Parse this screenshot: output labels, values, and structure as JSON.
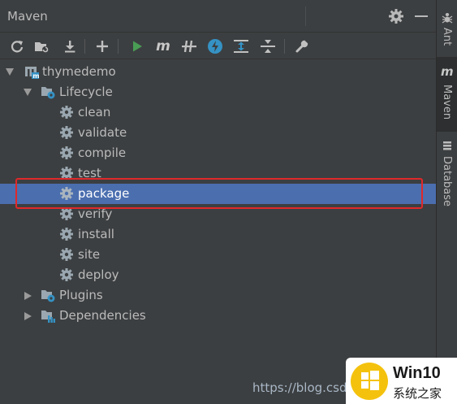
{
  "window": {
    "title": "Maven"
  },
  "toolbar": {
    "buttons": [
      {
        "name": "reload-all-icon"
      },
      {
        "name": "generate-sources-icon"
      },
      {
        "name": "download-icon"
      },
      {
        "name": "add-icon"
      },
      {
        "name": "run-icon"
      },
      {
        "name": "execute-goal-icon",
        "text": "m"
      },
      {
        "name": "skip-tests-icon"
      },
      {
        "name": "offline-mode-icon"
      },
      {
        "name": "show-dependencies-icon"
      },
      {
        "name": "collapse-all-icon"
      },
      {
        "name": "settings-wrench-icon"
      }
    ]
  },
  "tree": {
    "project": "thymedemo",
    "lifecycle": {
      "label": "Lifecycle",
      "goals": [
        "clean",
        "validate",
        "compile",
        "test",
        "package",
        "verify",
        "install",
        "site",
        "deploy"
      ],
      "selected": "package"
    },
    "plugins": "Plugins",
    "dependencies": "Dependencies"
  },
  "sidebar": {
    "tabs": [
      {
        "label": "Ant",
        "icon": "ant-icon"
      },
      {
        "label": "Maven",
        "icon": "maven-icon",
        "active": true
      },
      {
        "label": "Database",
        "icon": "database-icon"
      }
    ]
  },
  "overlay": {
    "watermark": "https://blog.csdn",
    "logo_title": "Win10",
    "logo_subtitle": "系统之家"
  },
  "colors": {
    "background": "#3c3f41",
    "selection": "#4b6eaf",
    "highlight_border": "#e0282a",
    "run_green": "#499c54",
    "offline_blue": "#3592c4"
  }
}
